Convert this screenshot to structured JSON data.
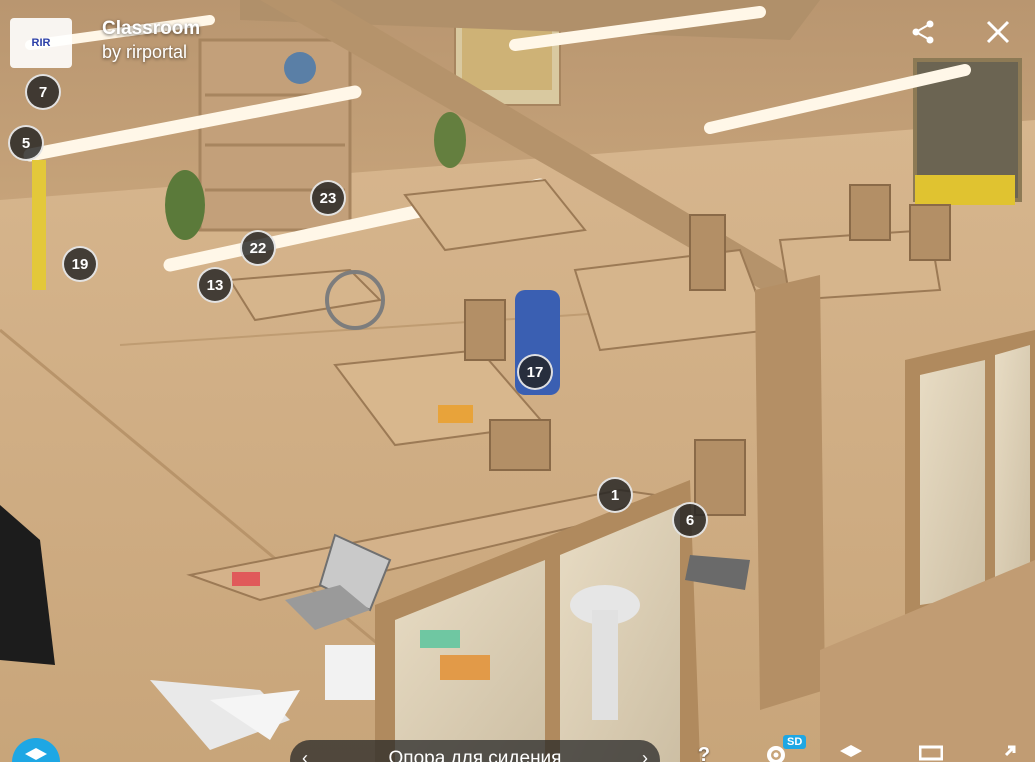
{
  "model": {
    "title": "Classroom",
    "author": "by rirportal",
    "logo_text": "RIR"
  },
  "top_controls": {
    "share_icon": "share-icon",
    "close_icon": "close-icon"
  },
  "hotspots": [
    {
      "number": "7"
    },
    {
      "number": "5"
    },
    {
      "number": "23"
    },
    {
      "number": "22"
    },
    {
      "number": "19"
    },
    {
      "number": "13"
    },
    {
      "number": "17"
    },
    {
      "number": "1"
    },
    {
      "number": "6"
    }
  ],
  "bottom_bar": {
    "annotation_label": "Опора для сидения",
    "prev_label": "‹",
    "next_label": "›",
    "help_label": "?",
    "quality_badge": "SD",
    "icons": [
      "layers-icon",
      "help-icon",
      "settings-icon",
      "vr-icon",
      "fullscreen-icon"
    ]
  },
  "colors": {
    "accent": "#1ea7e4",
    "hotspot_bg": "#232323",
    "scene_floor": "#cfae86"
  }
}
